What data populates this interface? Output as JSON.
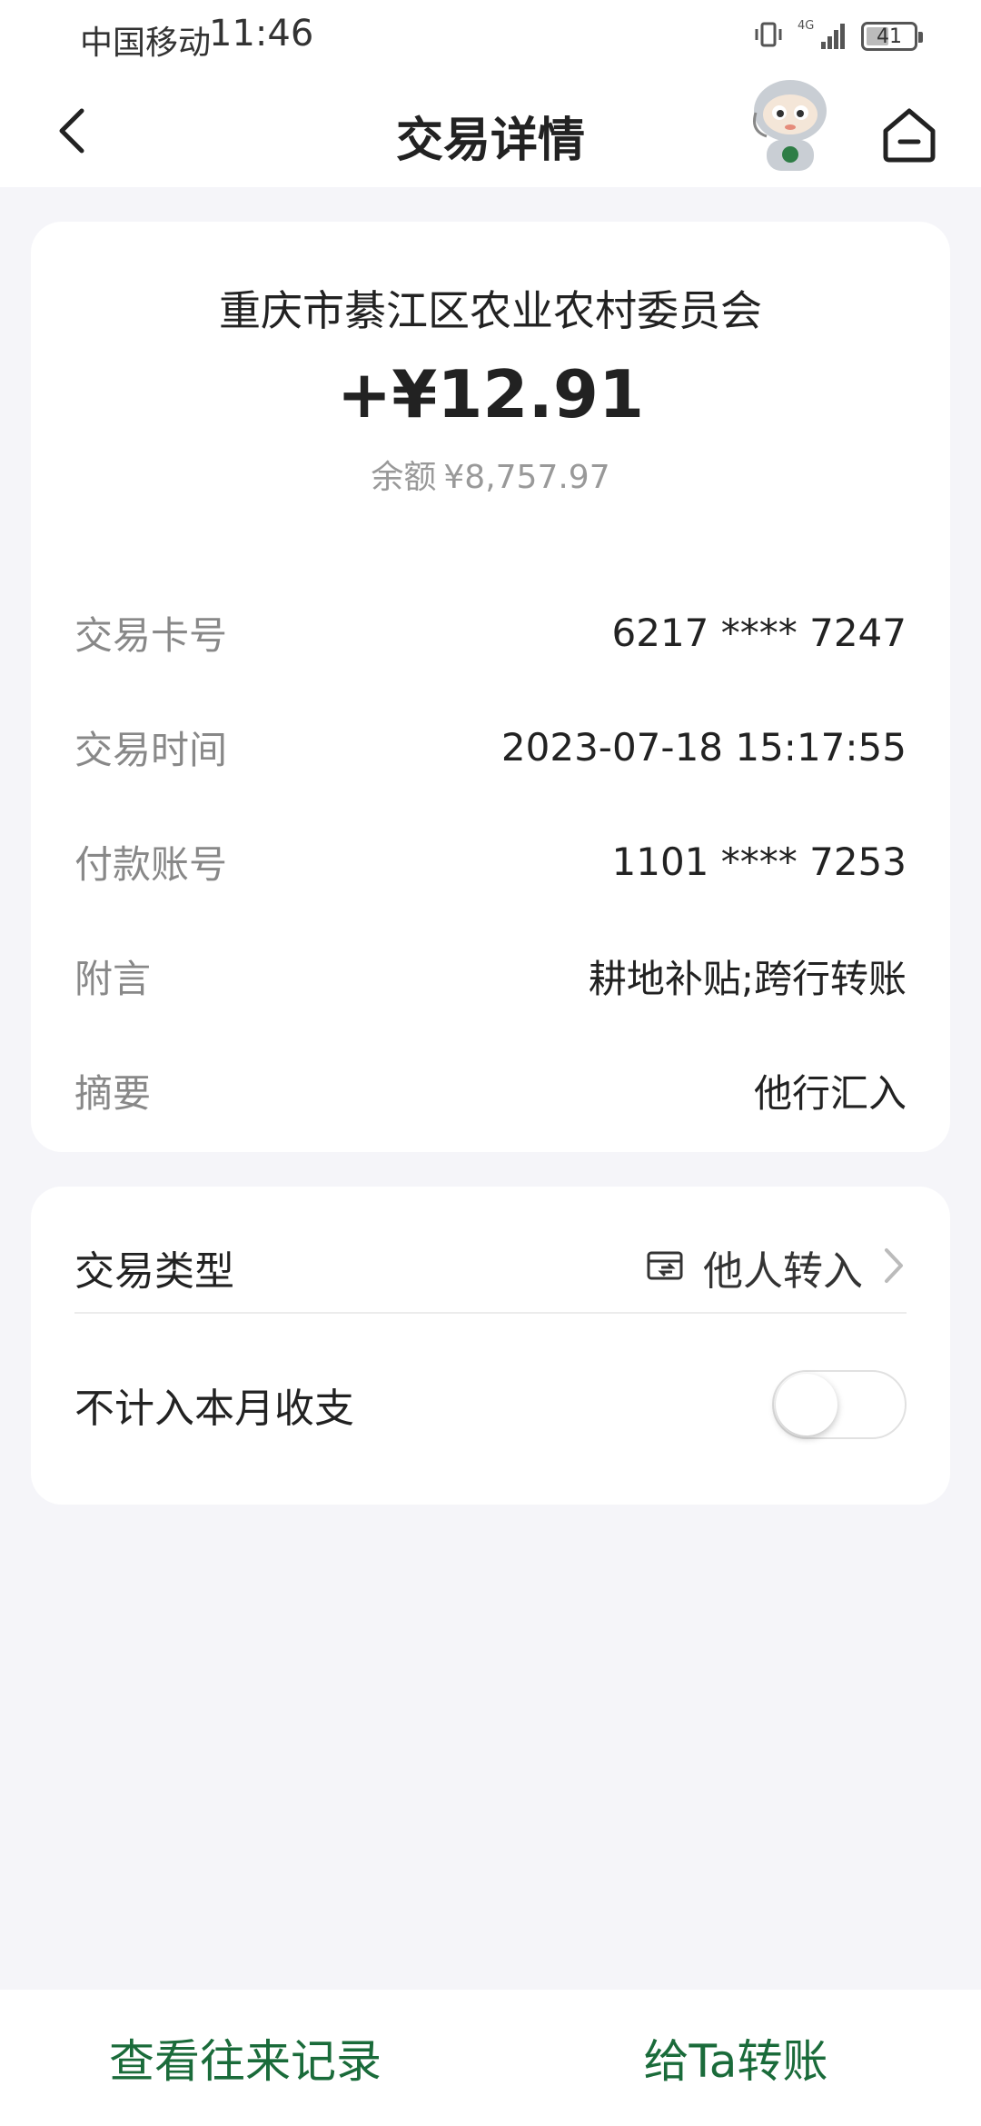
{
  "status_bar": {
    "carrier": "中国移动",
    "time": "11:46",
    "network": "4G",
    "battery": "41"
  },
  "header": {
    "title": "交易详情"
  },
  "transaction": {
    "payee": "重庆市綦江区农业农村委员会",
    "amount": "+¥12.91",
    "balance_label": "余额",
    "balance_value": "¥8,757.97",
    "details": [
      {
        "label": "交易卡号",
        "value": "6217 **** 7247"
      },
      {
        "label": "交易时间",
        "value": "2023-07-18 15:17:55"
      },
      {
        "label": "付款账号",
        "value": "1101 **** 7253"
      },
      {
        "label": "附言",
        "value": "耕地补贴;跨行转账"
      },
      {
        "label": "摘要",
        "value": "他行汇入"
      }
    ]
  },
  "category": {
    "type_label": "交易类型",
    "type_value": "他人转入",
    "exclude_label": "不计入本月收支",
    "exclude_enabled": false
  },
  "bottom": {
    "history_label": "查看往来记录",
    "transfer_label": "给Ta转账"
  },
  "colors": {
    "accent": "#1a6b3a",
    "background": "#f5f5f9"
  }
}
